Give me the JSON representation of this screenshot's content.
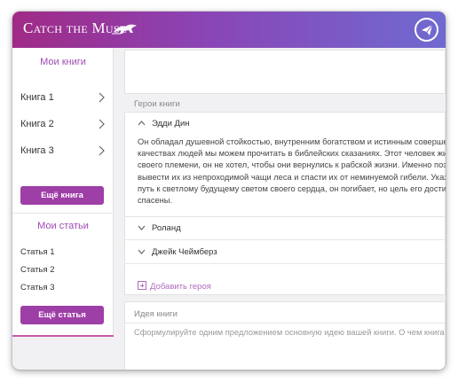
{
  "app": {
    "logo_text": "Catch the Muse"
  },
  "sidebar": {
    "books_title": "Мои книги",
    "books": [
      {
        "label": "Книга 1"
      },
      {
        "label": "Книга 2"
      },
      {
        "label": "Книга 3"
      }
    ],
    "more_books_button": "Ещё книга",
    "articles_title": "Мои статьи",
    "articles": [
      {
        "label": "Статья 1"
      },
      {
        "label": "Статья 2"
      },
      {
        "label": "Статья 3"
      }
    ],
    "more_articles_button": "Ещё статья"
  },
  "heroes": {
    "title": "Герои книги",
    "expanded": {
      "name": "Эдди Дин",
      "lines": [
        "Он обладал душевной стойкостью, внутренним богатством и истинным совершенст",
        "качествах людей мы можем прочитать в библейских сказаниях. Этот человек жил р",
        "своего племени, он не хотел, чтобы они вернулись к рабской жизни. Именно поэтом",
        "вывести их из непроходимой чащи леса и спасти их от неминуемой гибели. Указав",
        "путь к светлому будущему светом своего сердца, он погибает, но цель его достигну",
        "спасены."
      ]
    },
    "collapsed": [
      {
        "name": "Роланд"
      },
      {
        "name": "Джейк Чеймберз"
      }
    ],
    "add_label": "Добавить героя"
  },
  "idea": {
    "title": "Идея книги",
    "placeholder": "Сформулируйте одним предложением основную идею вашей книги. О чем книга"
  },
  "colors": {
    "header_gradient": [
      "#a02a86",
      "#6f6ad0"
    ],
    "accent": "#9e3ea7",
    "section_title": "#a04ab6"
  },
  "icons": {
    "send": "paper-plane-icon",
    "chevron_right": "chevron-right-icon",
    "chevron_down": "chevron-down-icon",
    "chevron_up": "chevron-up-icon",
    "add": "plus-square-icon"
  }
}
